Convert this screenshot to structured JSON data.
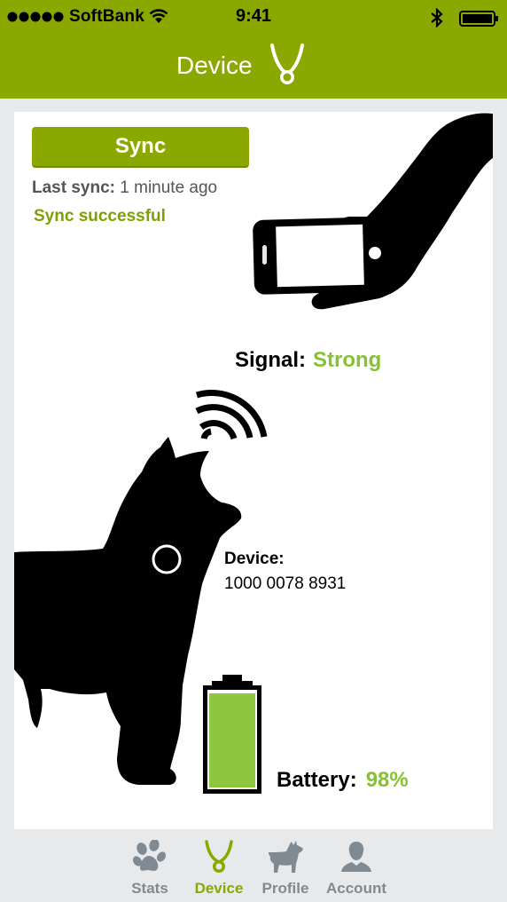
{
  "status_bar": {
    "carrier": "SoftBank",
    "time": "9:41"
  },
  "header": {
    "title": "Device"
  },
  "sync": {
    "button_label": "Sync",
    "last_sync_label": "Last sync:",
    "last_sync_value": "1 minute ago",
    "status": "Sync successful"
  },
  "signal": {
    "label": "Signal:",
    "value": "Strong"
  },
  "device": {
    "label": "Device:",
    "id": "1000 0078 8931"
  },
  "battery": {
    "label": "Battery:",
    "value": "98%",
    "level": 0.98
  },
  "tabs": [
    {
      "label": "Stats",
      "icon": "paw-icon",
      "active": false
    },
    {
      "label": "Device",
      "icon": "collar-icon",
      "active": true
    },
    {
      "label": "Profile",
      "icon": "dog-icon",
      "active": false
    },
    {
      "label": "Account",
      "icon": "person-icon",
      "active": false
    }
  ],
  "colors": {
    "brand": "#8aa800",
    "accent_green": "#86c232",
    "battery_fill": "#8dc63f",
    "background": "#e8e9eb",
    "tab_inactive": "#7f8a93"
  }
}
